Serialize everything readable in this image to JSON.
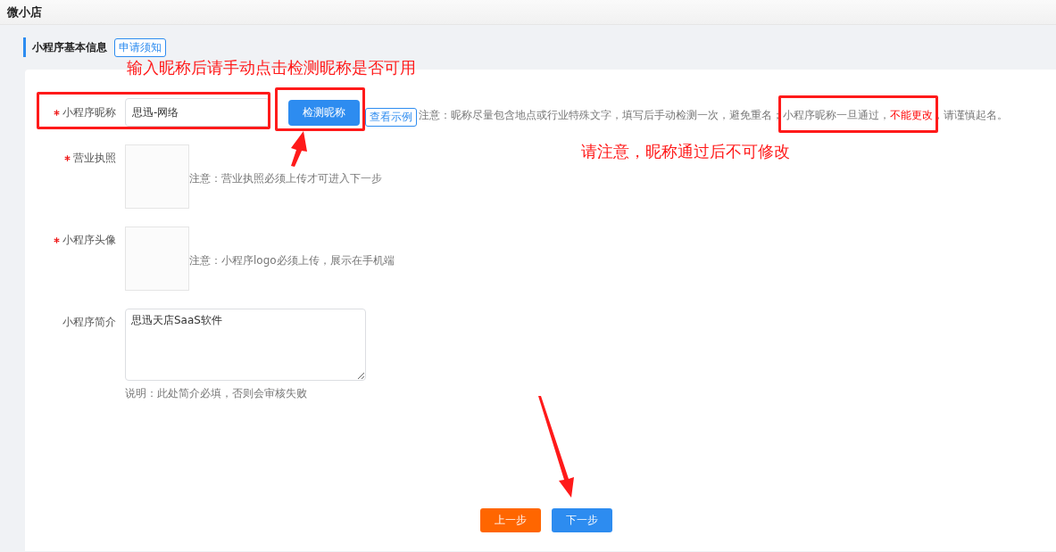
{
  "app_title": "微小店",
  "section": {
    "title": "小程序基本信息",
    "help_button": "申请须知"
  },
  "form": [
    {
      "kind": "nickname",
      "label": "小程序昵称",
      "required": true,
      "value": "思迅-网络",
      "check_button": "检测昵称",
      "example_button": "查看示例",
      "note": [
        {
          "text": "注意：昵称尽量包含地点或行业特殊文字，填写后手动检测一次，避免重名；",
          "warning": false
        },
        {
          "text": "小程序昵称一旦通过，",
          "warning": false
        },
        {
          "text": "不能更改",
          "warning": true
        },
        {
          "text": "，请谨慎起名。",
          "warning": false
        }
      ]
    },
    {
      "kind": "upload",
      "label": "营业执照",
      "required": true,
      "note": "注意：营业执照必须上传才可进入下一步"
    },
    {
      "kind": "upload",
      "label": "小程序头像",
      "required": true,
      "note": "注意：小程序logo必须上传，展示在手机端"
    },
    {
      "kind": "textarea",
      "label": "小程序简介",
      "required": false,
      "value": "思迅天店SaaS软件",
      "hint": "说明：此处简介必填，否则会审核失败"
    }
  ],
  "buttons": [
    {
      "kind": "prev",
      "label": "上一步"
    },
    {
      "kind": "next",
      "label": "下一步"
    }
  ],
  "annotations": [
    "输入昵称后请手动点击检测昵称是否可用",
    "请注意，昵称通过后不可修改"
  ]
}
